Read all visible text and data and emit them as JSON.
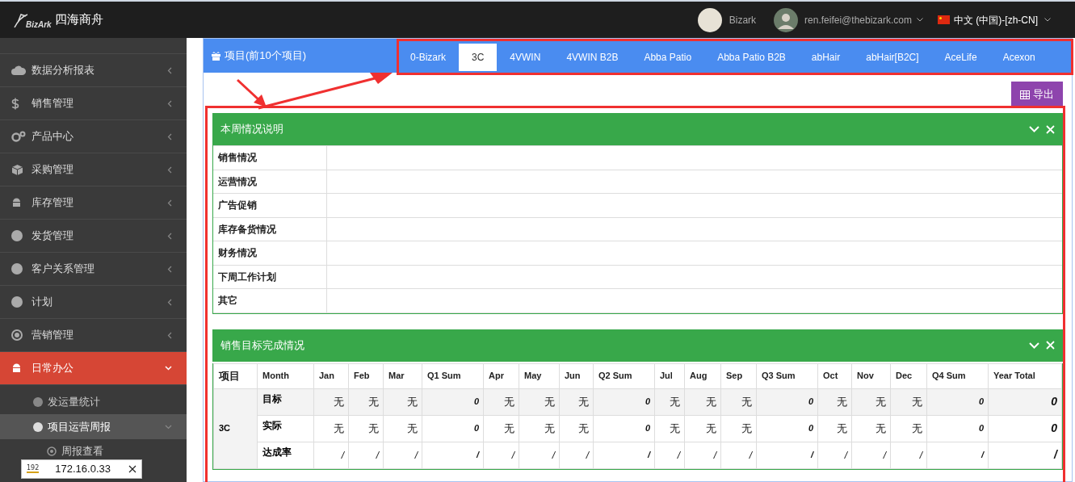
{
  "header": {
    "brand": "四海商舟",
    "logo_text": "BizArk",
    "store": "Bizark",
    "user": "ren.feifei@thebizark.com",
    "language": "中文 (中国)-[zh-CN]"
  },
  "sidebar": {
    "items": [
      {
        "label": "数据分析报表",
        "selected": false,
        "expanded": false
      },
      {
        "label": "销售管理",
        "selected": false,
        "expanded": false
      },
      {
        "label": "产品中心",
        "selected": false,
        "expanded": false
      },
      {
        "label": "采购管理",
        "selected": false,
        "expanded": false
      },
      {
        "label": "库存管理",
        "selected": false,
        "expanded": false
      },
      {
        "label": "发货管理",
        "selected": false,
        "expanded": false
      },
      {
        "label": "客户关系管理",
        "selected": false,
        "expanded": false
      },
      {
        "label": "计划",
        "selected": false,
        "expanded": false
      },
      {
        "label": "营销管理",
        "selected": false,
        "expanded": false
      },
      {
        "label": "日常办公",
        "selected": true,
        "expanded": true,
        "children": [
          {
            "label": "发运量统计",
            "selected": false,
            "expanded": false
          },
          {
            "label": "项目运营周报",
            "selected": true,
            "expanded": true,
            "children": [
              {
                "label": "周报查看",
                "selected": false
              }
            ]
          }
        ]
      }
    ]
  },
  "projects": {
    "title": "项目(前10个项目)",
    "tabs": [
      {
        "label": "0-Bizark",
        "selected": false
      },
      {
        "label": "3C",
        "selected": true
      },
      {
        "label": "4VWIN",
        "selected": false
      },
      {
        "label": "4VWIN B2B",
        "selected": false
      },
      {
        "label": "Abba Patio",
        "selected": false
      },
      {
        "label": "Abba Patio B2B",
        "selected": false
      },
      {
        "label": "abHair",
        "selected": false
      },
      {
        "label": "abHair[B2C]",
        "selected": false
      },
      {
        "label": "AceLife",
        "selected": false
      },
      {
        "label": "Acexon",
        "selected": false
      }
    ]
  },
  "export_button": "导出",
  "weekly_panel": {
    "title": "本周情况说明",
    "rows": [
      "销售情况",
      "运营情况",
      "广告促销",
      "库存备货情况",
      "财务情况",
      "下周工作计划",
      "其它"
    ]
  },
  "sales_panel": {
    "title": "销售目标完成情况",
    "columns": [
      "项目",
      "Month",
      "Jan",
      "Feb",
      "Mar",
      "Q1 Sum",
      "Apr",
      "May",
      "Jun",
      "Q2 Sum",
      "Jul",
      "Aug",
      "Sep",
      "Q3 Sum",
      "Oct",
      "Nov",
      "Dec",
      "Q4 Sum",
      "Year Total"
    ],
    "rows": [
      {
        "cells": [
          "",
          "目标",
          "无",
          "无",
          "无",
          "0",
          "无",
          "无",
          "无",
          "0",
          "无",
          "无",
          "无",
          "0",
          "无",
          "无",
          "无",
          "0",
          "0"
        ]
      },
      {
        "cells": [
          "3C",
          "实际",
          "无",
          "无",
          "无",
          "0",
          "无",
          "无",
          "无",
          "0",
          "无",
          "无",
          "无",
          "0",
          "无",
          "无",
          "无",
          "0",
          "0"
        ]
      },
      {
        "cells": [
          "",
          "达成率",
          "/",
          "/",
          "/",
          "/",
          "/",
          "/",
          "/",
          "/",
          "/",
          "/",
          "/",
          "/",
          "/",
          "/",
          "/",
          "/",
          "/"
        ]
      }
    ]
  },
  "ip_badge": {
    "address": "172.16.0.33",
    "icon_text": "192"
  }
}
